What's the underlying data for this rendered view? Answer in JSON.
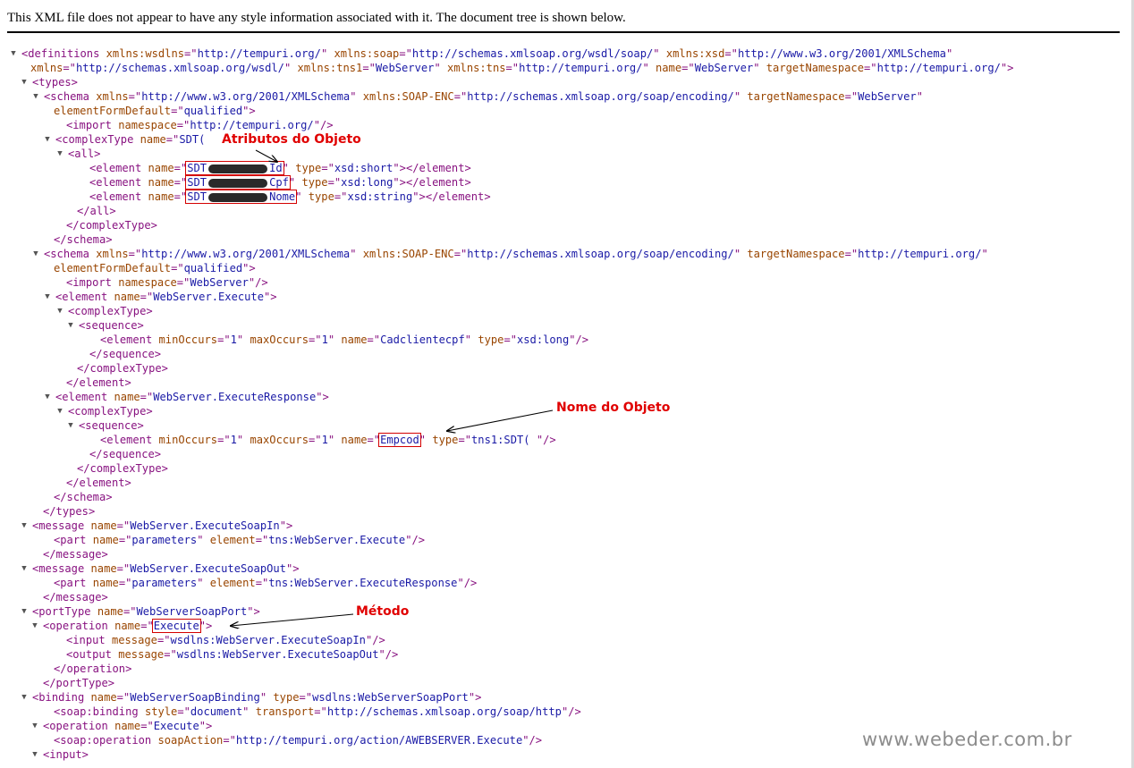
{
  "notice": "This XML file does not appear to have any style information associated with it. The document tree is shown below.",
  "toggle_glyph": "▼",
  "annotations": {
    "attributes": "Atributos do Objeto",
    "object_name": "Nome do Objeto",
    "method": "Método"
  },
  "watermark": "www.webeder.com.br",
  "xml_lines": [
    {
      "toggle": true,
      "parts": [
        [
          "t",
          "<definitions "
        ],
        [
          "n",
          "xmlns:wsdlns"
        ],
        [
          "b",
          "=\""
        ],
        [
          "v",
          "http://tempuri.org/"
        ],
        [
          "b",
          "\" "
        ],
        [
          "n",
          "xmlns:soap"
        ],
        [
          "b",
          "=\""
        ],
        [
          "v",
          "http://schemas.xmlsoap.org/wsdl/soap/"
        ],
        [
          "b",
          "\" "
        ],
        [
          "n",
          "xmlns:xsd"
        ],
        [
          "b",
          "=\""
        ],
        [
          "v",
          "http://www.w3.org/2001/XMLSchema"
        ],
        [
          "b",
          "\""
        ]
      ]
    },
    {
      "toggle": false,
      "parts": [
        [
          "n",
          "xmlns"
        ],
        [
          "b",
          "=\""
        ],
        [
          "v",
          "http://schemas.xmlsoap.org/wsdl/"
        ],
        [
          "b",
          "\" "
        ],
        [
          "n",
          "xmlns:tns1"
        ],
        [
          "b",
          "=\""
        ],
        [
          "v",
          "WebServer"
        ],
        [
          "b",
          "\" "
        ],
        [
          "n",
          "xmlns:tns"
        ],
        [
          "b",
          "=\""
        ],
        [
          "v",
          "http://tempuri.org/"
        ],
        [
          "b",
          "\" "
        ],
        [
          "n",
          "name"
        ],
        [
          "b",
          "=\""
        ],
        [
          "v",
          "WebServer"
        ],
        [
          "b",
          "\" "
        ],
        [
          "n",
          "targetNamespace"
        ],
        [
          "b",
          "=\""
        ],
        [
          "v",
          "http://tempuri.org/"
        ],
        [
          "b",
          "\">"
        ]
      ]
    },
    {
      "toggle": true,
      "parts": [
        [
          "t",
          "<types>"
        ]
      ]
    },
    {
      "toggle": true,
      "parts": [
        [
          "t",
          "<schema "
        ],
        [
          "n",
          "xmlns"
        ],
        [
          "b",
          "=\""
        ],
        [
          "v",
          "http://www.w3.org/2001/XMLSchema"
        ],
        [
          "b",
          "\" "
        ],
        [
          "n",
          "xmlns:SOAP-ENC"
        ],
        [
          "b",
          "=\""
        ],
        [
          "v",
          "http://schemas.xmlsoap.org/soap/encoding/"
        ],
        [
          "b",
          "\" "
        ],
        [
          "n",
          "targetNamespace"
        ],
        [
          "b",
          "=\""
        ],
        [
          "v",
          "WebServer"
        ],
        [
          "b",
          "\""
        ]
      ]
    },
    {
      "toggle": false,
      "parts": [
        [
          "n",
          "elementFormDefault"
        ],
        [
          "b",
          "=\""
        ],
        [
          "v",
          "qualified"
        ],
        [
          "b",
          "\">"
        ]
      ]
    },
    {
      "toggle": false,
      "parts": [
        [
          "t",
          "<import "
        ],
        [
          "n",
          "namespace"
        ],
        [
          "b",
          "=\""
        ],
        [
          "v",
          "http://tempuri.org/"
        ],
        [
          "b",
          "\"/>"
        ]
      ]
    },
    {
      "toggle": true,
      "parts": [
        [
          "t",
          "<complexType "
        ],
        [
          "n",
          "name"
        ],
        [
          "b",
          "=\""
        ],
        [
          "v",
          "SDT("
        ]
      ]
    },
    {
      "toggle": true,
      "parts": [
        [
          "t",
          "<all>"
        ]
      ]
    },
    {
      "toggle": false,
      "parts": [
        [
          "t",
          "<element "
        ],
        [
          "n",
          "name"
        ],
        [
          "b",
          "=\""
        ],
        [
          "hl",
          "SDT",
          true,
          "Id"
        ],
        [
          "b",
          "\" "
        ],
        [
          "n",
          "type"
        ],
        [
          "b",
          "=\""
        ],
        [
          "v",
          "xsd:short"
        ],
        [
          "b",
          "\">"
        ],
        [
          "t",
          "</element>"
        ]
      ]
    },
    {
      "toggle": false,
      "parts": [
        [
          "t",
          "<element "
        ],
        [
          "n",
          "name"
        ],
        [
          "b",
          "=\""
        ],
        [
          "hl",
          "SDT",
          true,
          "Cpf"
        ],
        [
          "b",
          "\" "
        ],
        [
          "n",
          "type"
        ],
        [
          "b",
          "=\""
        ],
        [
          "v",
          "xsd:long"
        ],
        [
          "b",
          "\">"
        ],
        [
          "t",
          "</element>"
        ]
      ]
    },
    {
      "toggle": false,
      "parts": [
        [
          "t",
          "<element "
        ],
        [
          "n",
          "name"
        ],
        [
          "b",
          "=\""
        ],
        [
          "hl",
          "SDT",
          true,
          "Nome"
        ],
        [
          "b",
          "\" "
        ],
        [
          "n",
          "type"
        ],
        [
          "b",
          "=\""
        ],
        [
          "v",
          "xsd:string"
        ],
        [
          "b",
          "\">"
        ],
        [
          "t",
          "</element>"
        ]
      ]
    },
    {
      "toggle": false,
      "parts": [
        [
          "t",
          "</all>"
        ]
      ]
    },
    {
      "toggle": false,
      "parts": [
        [
          "t",
          "</complexType>"
        ]
      ]
    },
    {
      "toggle": false,
      "parts": [
        [
          "t",
          "</schema>"
        ]
      ]
    },
    {
      "toggle": true,
      "parts": [
        [
          "t",
          "<schema "
        ],
        [
          "n",
          "xmlns"
        ],
        [
          "b",
          "=\""
        ],
        [
          "v",
          "http://www.w3.org/2001/XMLSchema"
        ],
        [
          "b",
          "\" "
        ],
        [
          "n",
          "xmlns:SOAP-ENC"
        ],
        [
          "b",
          "=\""
        ],
        [
          "v",
          "http://schemas.xmlsoap.org/soap/encoding/"
        ],
        [
          "b",
          "\" "
        ],
        [
          "n",
          "targetNamespace"
        ],
        [
          "b",
          "=\""
        ],
        [
          "v",
          "http://tempuri.org/"
        ],
        [
          "b",
          "\""
        ]
      ]
    },
    {
      "toggle": false,
      "parts": [
        [
          "n",
          "elementFormDefault"
        ],
        [
          "b",
          "=\""
        ],
        [
          "v",
          "qualified"
        ],
        [
          "b",
          "\">"
        ]
      ]
    },
    {
      "toggle": false,
      "parts": [
        [
          "t",
          "<import "
        ],
        [
          "n",
          "namespace"
        ],
        [
          "b",
          "=\""
        ],
        [
          "v",
          "WebServer"
        ],
        [
          "b",
          "\"/>"
        ]
      ]
    },
    {
      "toggle": true,
      "parts": [
        [
          "t",
          "<element "
        ],
        [
          "n",
          "name"
        ],
        [
          "b",
          "=\""
        ],
        [
          "v",
          "WebServer.Execute"
        ],
        [
          "b",
          "\">"
        ]
      ]
    },
    {
      "toggle": true,
      "parts": [
        [
          "t",
          "<complexType>"
        ]
      ]
    },
    {
      "toggle": true,
      "parts": [
        [
          "t",
          "<sequence>"
        ]
      ]
    },
    {
      "toggle": false,
      "parts": [
        [
          "t",
          "<element "
        ],
        [
          "n",
          "minOccurs"
        ],
        [
          "b",
          "=\""
        ],
        [
          "v",
          "1"
        ],
        [
          "b",
          "\" "
        ],
        [
          "n",
          "maxOccurs"
        ],
        [
          "b",
          "=\""
        ],
        [
          "v",
          "1"
        ],
        [
          "b",
          "\" "
        ],
        [
          "n",
          "name"
        ],
        [
          "b",
          "=\""
        ],
        [
          "v",
          "Cadclientecpf"
        ],
        [
          "b",
          "\" "
        ],
        [
          "n",
          "type"
        ],
        [
          "b",
          "=\""
        ],
        [
          "v",
          "xsd:long"
        ],
        [
          "b",
          "\"/>"
        ]
      ]
    },
    {
      "toggle": false,
      "parts": [
        [
          "t",
          "</sequence>"
        ]
      ]
    },
    {
      "toggle": false,
      "parts": [
        [
          "t",
          "</complexType>"
        ]
      ]
    },
    {
      "toggle": false,
      "parts": [
        [
          "t",
          "</element>"
        ]
      ]
    },
    {
      "toggle": true,
      "parts": [
        [
          "t",
          "<element "
        ],
        [
          "n",
          "name"
        ],
        [
          "b",
          "=\""
        ],
        [
          "v",
          "WebServer.ExecuteResponse"
        ],
        [
          "b",
          "\">"
        ]
      ]
    },
    {
      "toggle": true,
      "parts": [
        [
          "t",
          "<complexType>"
        ]
      ]
    },
    {
      "toggle": true,
      "parts": [
        [
          "t",
          "<sequence>"
        ]
      ]
    },
    {
      "toggle": false,
      "parts": [
        [
          "t",
          "<element "
        ],
        [
          "n",
          "minOccurs"
        ],
        [
          "b",
          "=\""
        ],
        [
          "v",
          "1"
        ],
        [
          "b",
          "\" "
        ],
        [
          "n",
          "maxOccurs"
        ],
        [
          "b",
          "=\""
        ],
        [
          "v",
          "1"
        ],
        [
          "b",
          "\" "
        ],
        [
          "n",
          "name"
        ],
        [
          "b",
          "=\""
        ],
        [
          "hl",
          "Empcod",
          false,
          ""
        ],
        [
          "b",
          "\" "
        ],
        [
          "n",
          "type"
        ],
        [
          "b",
          "=\""
        ],
        [
          "v",
          "tns1:SDT(          "
        ],
        [
          "b",
          "\"/>"
        ]
      ]
    },
    {
      "toggle": false,
      "parts": [
        [
          "t",
          "</sequence>"
        ]
      ]
    },
    {
      "toggle": false,
      "parts": [
        [
          "t",
          "</complexType>"
        ]
      ]
    },
    {
      "toggle": false,
      "parts": [
        [
          "t",
          "</element>"
        ]
      ]
    },
    {
      "toggle": false,
      "parts": [
        [
          "t",
          "</schema>"
        ]
      ]
    },
    {
      "toggle": false,
      "parts": [
        [
          "t",
          "</types>"
        ]
      ]
    },
    {
      "toggle": true,
      "parts": [
        [
          "t",
          "<message "
        ],
        [
          "n",
          "name"
        ],
        [
          "b",
          "=\""
        ],
        [
          "v",
          "WebServer.ExecuteSoapIn"
        ],
        [
          "b",
          "\">"
        ]
      ]
    },
    {
      "toggle": false,
      "parts": [
        [
          "t",
          "<part "
        ],
        [
          "n",
          "name"
        ],
        [
          "b",
          "=\""
        ],
        [
          "v",
          "parameters"
        ],
        [
          "b",
          "\" "
        ],
        [
          "n",
          "element"
        ],
        [
          "b",
          "=\""
        ],
        [
          "v",
          "tns:WebServer.Execute"
        ],
        [
          "b",
          "\"/>"
        ]
      ]
    },
    {
      "toggle": false,
      "parts": [
        [
          "t",
          "</message>"
        ]
      ]
    },
    {
      "toggle": true,
      "parts": [
        [
          "t",
          "<message "
        ],
        [
          "n",
          "name"
        ],
        [
          "b",
          "=\""
        ],
        [
          "v",
          "WebServer.ExecuteSoapOut"
        ],
        [
          "b",
          "\">"
        ]
      ]
    },
    {
      "toggle": false,
      "parts": [
        [
          "t",
          "<part "
        ],
        [
          "n",
          "name"
        ],
        [
          "b",
          "=\""
        ],
        [
          "v",
          "parameters"
        ],
        [
          "b",
          "\" "
        ],
        [
          "n",
          "element"
        ],
        [
          "b",
          "=\""
        ],
        [
          "v",
          "tns:WebServer.ExecuteResponse"
        ],
        [
          "b",
          "\"/>"
        ]
      ]
    },
    {
      "toggle": false,
      "parts": [
        [
          "t",
          "</message>"
        ]
      ]
    },
    {
      "toggle": true,
      "parts": [
        [
          "t",
          "<portType "
        ],
        [
          "n",
          "name"
        ],
        [
          "b",
          "=\""
        ],
        [
          "v",
          "WebServerSoapPort"
        ],
        [
          "b",
          "\">"
        ]
      ]
    },
    {
      "toggle": true,
      "parts": [
        [
          "t",
          "<operation "
        ],
        [
          "n",
          "name"
        ],
        [
          "b",
          "=\""
        ],
        [
          "hl",
          "Execute",
          false,
          ""
        ],
        [
          "b",
          "\">"
        ]
      ]
    },
    {
      "toggle": false,
      "parts": [
        [
          "t",
          "<input "
        ],
        [
          "n",
          "message"
        ],
        [
          "b",
          "=\""
        ],
        [
          "v",
          "wsdlns:WebServer.ExecuteSoapIn"
        ],
        [
          "b",
          "\"/>"
        ]
      ]
    },
    {
      "toggle": false,
      "parts": [
        [
          "t",
          "<output "
        ],
        [
          "n",
          "message"
        ],
        [
          "b",
          "=\""
        ],
        [
          "v",
          "wsdlns:WebServer.ExecuteSoapOut"
        ],
        [
          "b",
          "\"/>"
        ]
      ]
    },
    {
      "toggle": false,
      "parts": [
        [
          "t",
          "</operation>"
        ]
      ]
    },
    {
      "toggle": false,
      "parts": [
        [
          "t",
          "</portType>"
        ]
      ]
    },
    {
      "toggle": true,
      "parts": [
        [
          "t",
          "<binding "
        ],
        [
          "n",
          "name"
        ],
        [
          "b",
          "=\""
        ],
        [
          "v",
          "WebServerSoapBinding"
        ],
        [
          "b",
          "\" "
        ],
        [
          "n",
          "type"
        ],
        [
          "b",
          "=\""
        ],
        [
          "v",
          "wsdlns:WebServerSoapPort"
        ],
        [
          "b",
          "\">"
        ]
      ]
    },
    {
      "toggle": false,
      "parts": [
        [
          "t",
          "<soap:binding "
        ],
        [
          "n",
          "style"
        ],
        [
          "b",
          "=\""
        ],
        [
          "v",
          "document"
        ],
        [
          "b",
          "\" "
        ],
        [
          "n",
          "transport"
        ],
        [
          "b",
          "=\""
        ],
        [
          "v",
          "http://schemas.xmlsoap.org/soap/http"
        ],
        [
          "b",
          "\"/>"
        ]
      ]
    },
    {
      "toggle": true,
      "parts": [
        [
          "t",
          "<operation "
        ],
        [
          "n",
          "name"
        ],
        [
          "b",
          "=\""
        ],
        [
          "v",
          "Execute"
        ],
        [
          "b",
          "\">"
        ]
      ]
    },
    {
      "toggle": false,
      "parts": [
        [
          "t",
          "<soap:operation "
        ],
        [
          "n",
          "soapAction"
        ],
        [
          "b",
          "=\""
        ],
        [
          "v",
          "http://tempuri.org/action/AWEBSERVER.Execute"
        ],
        [
          "b",
          "\"/>"
        ]
      ]
    },
    {
      "toggle": true,
      "parts": [
        [
          "t",
          "<input>"
        ]
      ]
    }
  ]
}
